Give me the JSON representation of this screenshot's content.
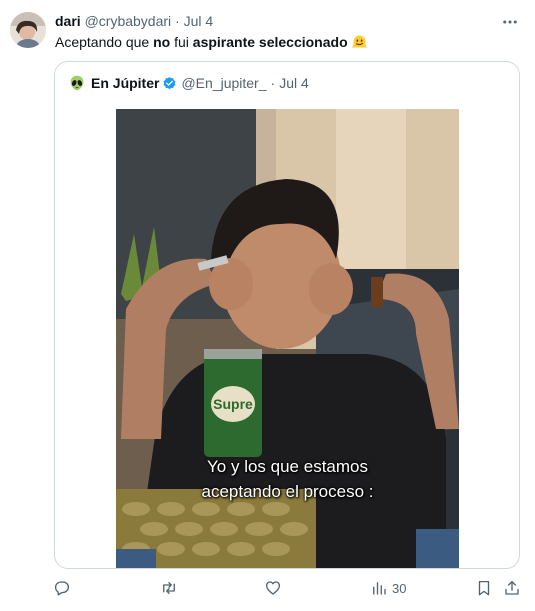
{
  "tweet": {
    "display_name": "dari",
    "handle": "@crybabydari",
    "separator": "·",
    "date": "Jul 4",
    "text_before": "Aceptando que ",
    "text_bold1": "no",
    "text_middle": " fui ",
    "text_bold2": "aspirante seleccionado",
    "emoji": "melting-face"
  },
  "quote": {
    "avatar_emoji": "alien",
    "display_name": "En Júpiter",
    "handle": "@En_jupiter_",
    "separator": "·",
    "date": "Jul 4",
    "verified": true,
    "media": {
      "caption_line1": "Yo y los que estamos",
      "caption_line2": "aceptando el proceso :",
      "can_text": "Supre"
    }
  },
  "actions": {
    "reply_count": "",
    "retweet_count": "",
    "like_count": "",
    "views_count": "30"
  },
  "colors": {
    "text": "#0f1419",
    "muted": "#536471",
    "border": "#cfd9de",
    "verified_blue": "#1d9bf0"
  }
}
